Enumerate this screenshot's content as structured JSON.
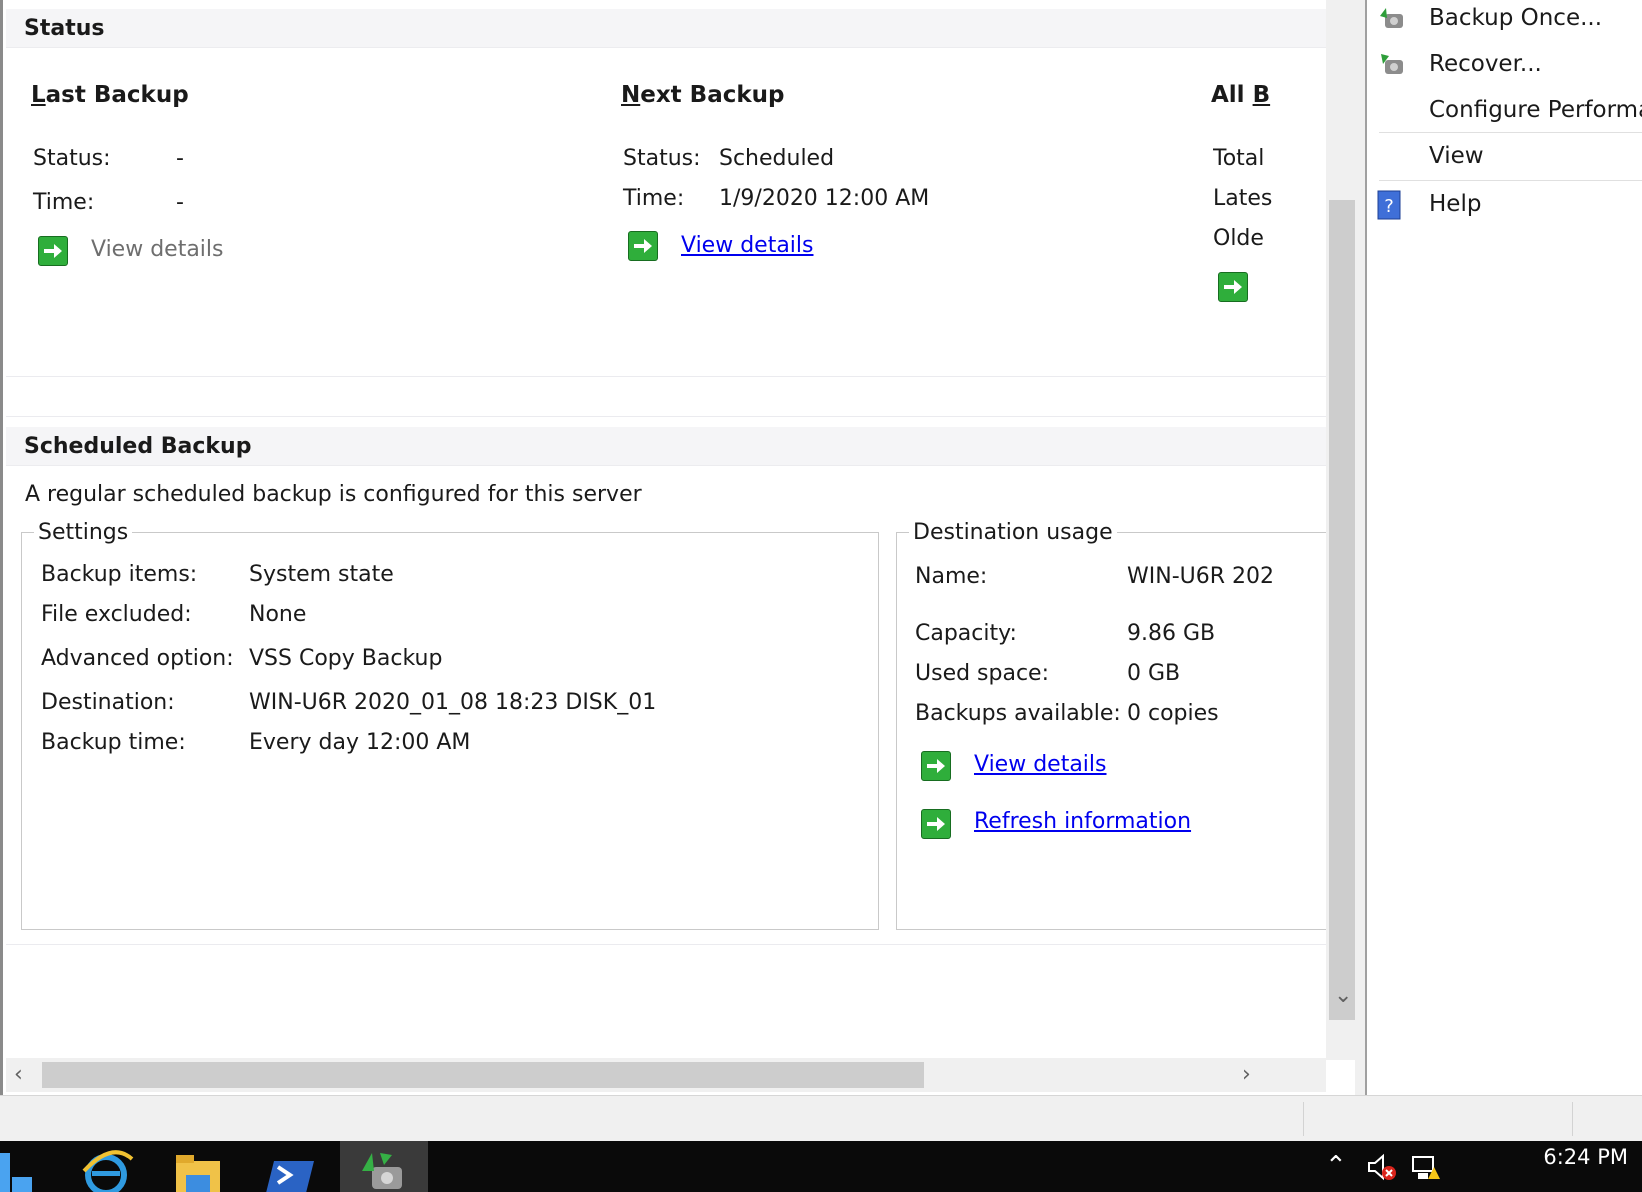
{
  "status_section": {
    "header": "Status",
    "last_backup": {
      "title_accel": "L",
      "title_rest": "ast Backup",
      "status_label": "Status:",
      "status_value": "-",
      "time_label": "Time:",
      "time_value": "-",
      "details_link": "View details"
    },
    "next_backup": {
      "title_accel": "N",
      "title_rest": "ext Backup",
      "status_label": "Status:",
      "status_value": "Scheduled",
      "time_label": "Time:",
      "time_value": "1/9/2020 12:00 AM",
      "details_link": "View details"
    },
    "all_backups": {
      "title_visible": "All ",
      "title_accel": "B",
      "row1_label": "Total",
      "row2_label": "Lates",
      "row3_label": "Olde"
    }
  },
  "scheduled_section": {
    "header": "Scheduled Backup",
    "summary": "A regular scheduled backup is configured for this server",
    "settings": {
      "legend": "Settings",
      "rows": [
        {
          "label": "Backup items:",
          "value": "System state"
        },
        {
          "label": "File excluded:",
          "value": "None"
        },
        {
          "label": "Advanced option:",
          "value": "VSS Copy Backup"
        },
        {
          "label": "Destination:",
          "value": "WIN-U6R 2020_01_08 18:23 DISK_01"
        },
        {
          "label": "Backup time:",
          "value": "Every day 12:00 AM"
        }
      ]
    },
    "destination_usage": {
      "legend": "Destination usage",
      "name_label": "Name:",
      "name_value": "WIN-U6R 202",
      "capacity_label": "Capacity:",
      "capacity_value": "9.86 GB",
      "used_label": "Used space:",
      "used_value": "0 GB",
      "available_label": "Backups available:",
      "available_value": "0 copies",
      "details_link": "View details",
      "refresh_link": "Refresh information"
    }
  },
  "actions_pane": {
    "items": [
      {
        "label": "Backup Once...",
        "icon": "backup-once-icon"
      },
      {
        "label": "Recover...",
        "icon": "recover-icon"
      },
      {
        "label": "Configure Performa",
        "icon": ""
      },
      {
        "label": "View",
        "icon": ""
      },
      {
        "label": "Help",
        "icon": "help-icon"
      }
    ]
  },
  "taskbar": {
    "clock_time": "6:24 PM",
    "buttons": [
      "start-icon",
      "internet-explorer-icon",
      "file-explorer-icon",
      "powershell-icon",
      "windows-server-backup-icon"
    ]
  },
  "colors": {
    "link": "#0000ee",
    "go_icon": "#2fae3b",
    "section_header_bg": "#f5f5f7",
    "taskbar": "#0a0a0a"
  }
}
